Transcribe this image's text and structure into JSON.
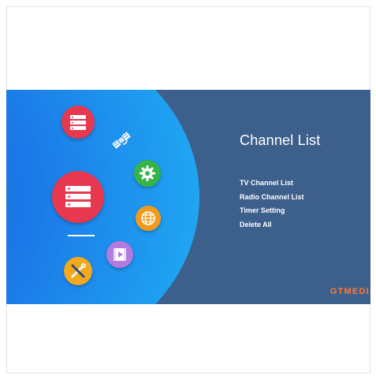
{
  "screen": {
    "title": "Channel List",
    "menu": [
      "TV Channel List",
      "Radio Channel List",
      "Timer Setting",
      "Delete All"
    ],
    "brand": "GTMEDIA"
  },
  "icons": [
    {
      "name": "channel-list-icon",
      "selected": true
    },
    {
      "name": "satellite-icon"
    },
    {
      "name": "settings-gear-icon"
    },
    {
      "name": "channel-list-large-icon"
    },
    {
      "name": "network-globe-icon"
    },
    {
      "name": "media-player-icon"
    },
    {
      "name": "tools-icon"
    }
  ],
  "colors": {
    "screen_bg": "#3d5f8c",
    "wheel_blue": "#1b7ae8",
    "accent_red": "#e8384f",
    "green": "#35b44a",
    "orange": "#f39a1d",
    "purple": "#b37be0",
    "brand": "#ff7a35"
  }
}
